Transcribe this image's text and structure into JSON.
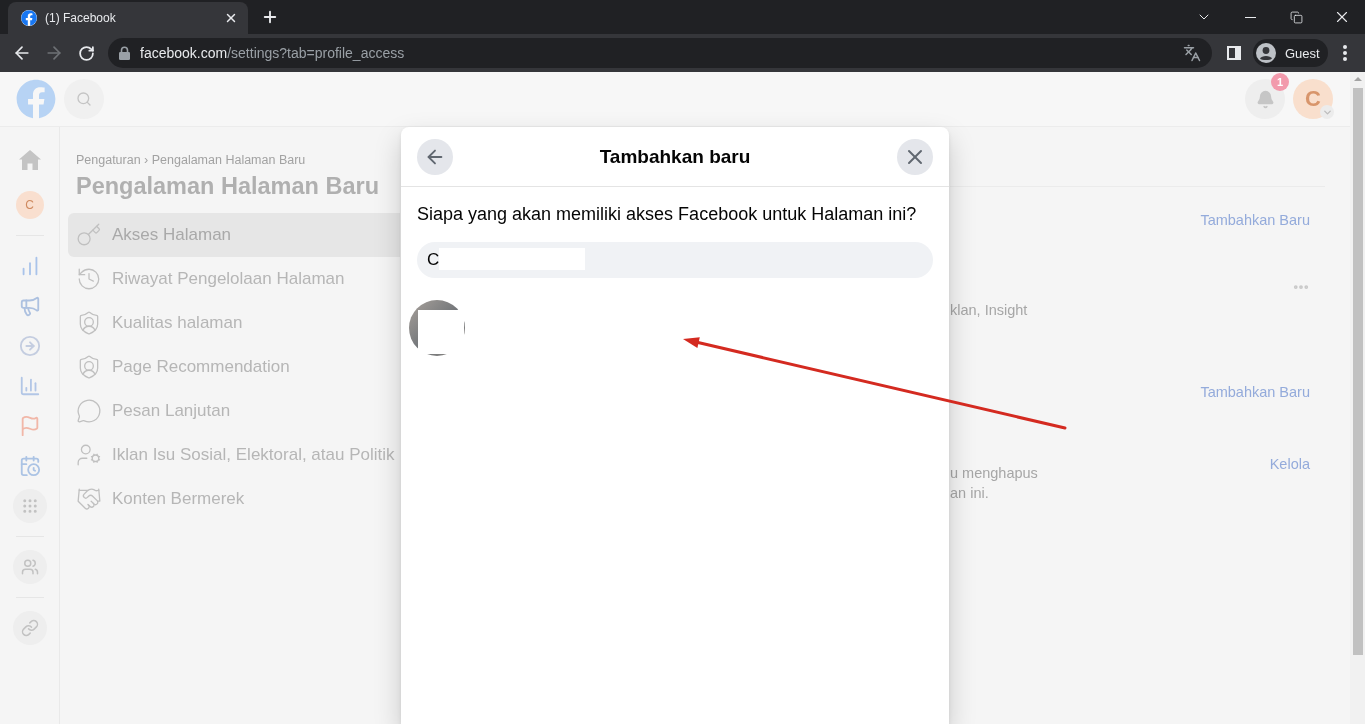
{
  "browser": {
    "tab": {
      "title": "(1) Facebook"
    },
    "nav": {
      "forward_disabled": true
    },
    "address": {
      "host": "facebook.com",
      "path": "/settings?tab=profile_access"
    },
    "profile": {
      "label": "Guest"
    }
  },
  "header": {
    "notifications": {
      "badge": "1"
    },
    "account": {
      "initial": "C"
    }
  },
  "rail": {
    "page_initial": "C"
  },
  "settings": {
    "breadcrumb": "Pengaturan › Pengalaman Halaman Baru",
    "title": "Pengalaman Halaman Baru",
    "items": [
      {
        "label": "Akses Halaman",
        "selected": true
      },
      {
        "label": "Riwayat Pengelolaan Halaman",
        "selected": false
      },
      {
        "label": "Kualitas halaman",
        "selected": false
      },
      {
        "label": "Page Recommendation",
        "selected": false
      },
      {
        "label": "Pesan Lanjutan",
        "selected": false
      },
      {
        "label": "Iklan Isu Sosial, Elektoral, atau Politik",
        "selected": false
      },
      {
        "label": "Konten Bermerek",
        "selected": false
      }
    ]
  },
  "content": {
    "rows": [
      {
        "action": "Tambahkan Baru",
        "menu": false
      },
      {
        "description": [
          "klan, Insight"
        ],
        "menu": true
      },
      {
        "action": "Tambahkan Baru",
        "menu": false
      },
      {
        "action": "Kelola",
        "description": [
          "u menghapus",
          "an ini."
        ],
        "menu": false
      }
    ]
  },
  "dialog": {
    "title": "Tambahkan baru",
    "prompt": "Siapa yang akan memiliki akses Facebook untuk Halaman ini?",
    "search": {
      "value": "C",
      "redacted": true
    },
    "results": [
      {
        "redacted": true
      }
    ]
  }
}
